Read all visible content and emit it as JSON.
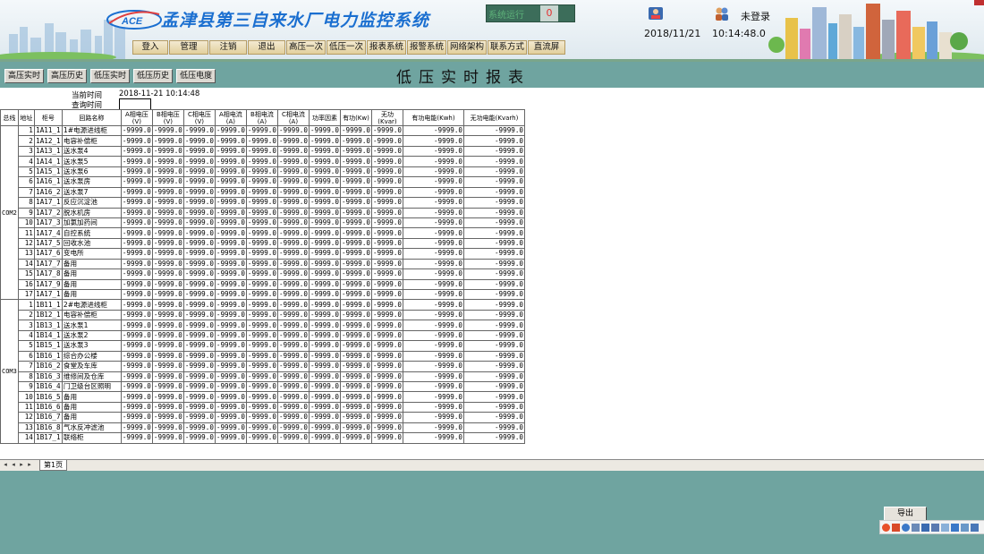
{
  "header": {
    "app_title": "孟津县第三自来水厂电力监控系统",
    "logo_text": "ACE",
    "run_status_label": "系统运行",
    "run_status_count": "0",
    "date": "2018/11/21",
    "time": "10:14:48.0",
    "login_status": "未登录",
    "nav": [
      "登入",
      "管理",
      "注销",
      "退出",
      "高压一次",
      "低压一次",
      "报表系统",
      "报警系统",
      "网络架构",
      "联系方式",
      "直流屏"
    ]
  },
  "toolbar": {
    "report_tabs": [
      "高压实时",
      "高压历史",
      "低压实时",
      "低压历史",
      "低压电度"
    ],
    "page_title": "低压实时报表"
  },
  "meta": {
    "current_time_label": "当前时间",
    "current_time_value": "2018-11-21 10:14:48",
    "query_time_label": "查询时间"
  },
  "table": {
    "headers": [
      "总线",
      "地址",
      "柜号",
      "回路名称",
      "A相电压(V)",
      "B相电压(V)",
      "C相电压(V)",
      "A相电流(A)",
      "B相电流(A)",
      "C相电流(A)",
      "功率因素",
      "有功(Kw)",
      "无功(Kvar)",
      "有功电能(Kwh)",
      "无功电能(Kvarh)"
    ],
    "placeholder_value": "-9999.0",
    "groups": [
      {
        "bus": "COM2",
        "rows": [
          {
            "addr": "1",
            "cab": "1A11_1",
            "name": "1#电源进线柜"
          },
          {
            "addr": "2",
            "cab": "1A12_1",
            "name": "电容补偿柜"
          },
          {
            "addr": "3",
            "cab": "1A13_1",
            "name": "送水泵4"
          },
          {
            "addr": "4",
            "cab": "1A14_1",
            "name": "送水泵5"
          },
          {
            "addr": "5",
            "cab": "1A15_1",
            "name": "送水泵6"
          },
          {
            "addr": "6",
            "cab": "1A16_1",
            "name": "送水泵房"
          },
          {
            "addr": "7",
            "cab": "1A16_2",
            "name": "送水泵7"
          },
          {
            "addr": "8",
            "cab": "1A17_1",
            "name": "反应沉淀池"
          },
          {
            "addr": "9",
            "cab": "1A17_2",
            "name": "脱水机房"
          },
          {
            "addr": "10",
            "cab": "1A17_3",
            "name": "加氯加药间"
          },
          {
            "addr": "11",
            "cab": "1A17_4",
            "name": "自控系统"
          },
          {
            "addr": "12",
            "cab": "1A17_5",
            "name": "回收水池"
          },
          {
            "addr": "13",
            "cab": "1A17_6",
            "name": "变电所"
          },
          {
            "addr": "14",
            "cab": "1A17_7",
            "name": "备用"
          },
          {
            "addr": "15",
            "cab": "1A17_8",
            "name": "备用"
          },
          {
            "addr": "16",
            "cab": "1A17_9",
            "name": "备用"
          },
          {
            "addr": "17",
            "cab": "1A17_1",
            "name": "备用"
          }
        ]
      },
      {
        "bus": "COM3",
        "rows": [
          {
            "addr": "1",
            "cab": "1B11_1",
            "name": "2#电源进线柜"
          },
          {
            "addr": "2",
            "cab": "1B12_1",
            "name": "电容补偿柜"
          },
          {
            "addr": "3",
            "cab": "1B13_1",
            "name": "送水泵1"
          },
          {
            "addr": "4",
            "cab": "1B14_1",
            "name": "送水泵2"
          },
          {
            "addr": "5",
            "cab": "1B15_1",
            "name": "送水泵3"
          },
          {
            "addr": "6",
            "cab": "1B16_1",
            "name": "综合办公楼"
          },
          {
            "addr": "7",
            "cab": "1B16_2",
            "name": "食堂及车库"
          },
          {
            "addr": "8",
            "cab": "1B16_3",
            "name": "维修间及仓库"
          },
          {
            "addr": "9",
            "cab": "1B16_4",
            "name": "门卫级台区照明"
          },
          {
            "addr": "10",
            "cab": "1B16_5",
            "name": "备用"
          },
          {
            "addr": "11",
            "cab": "1B16_6",
            "name": "备用"
          },
          {
            "addr": "12",
            "cab": "1B16_7",
            "name": "备用"
          },
          {
            "addr": "13",
            "cab": "1B16_8",
            "name": "气水反冲滤池"
          },
          {
            "addr": "14",
            "cab": "1B17_1",
            "name": "联络柜"
          }
        ]
      }
    ]
  },
  "sheet_tabs": {
    "nav_icons": [
      "first-icon",
      "prev-icon",
      "next-icon",
      "last-icon"
    ],
    "active_tab": "第1页"
  },
  "export_label": "导出",
  "colors": {
    "background": "#6fa4a0",
    "title_blue": "#1b6fd0",
    "status_green": "#3c6d5a",
    "status_red": "#e53030"
  }
}
